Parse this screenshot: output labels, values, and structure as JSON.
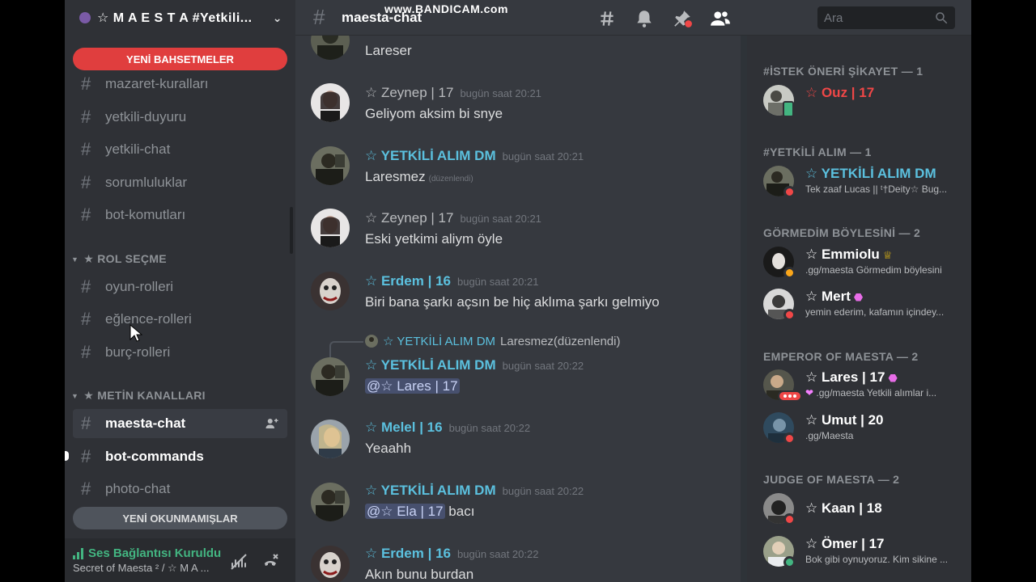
{
  "watermark": "www.BANDICAM.com",
  "guild": {
    "name": "☆ M A E S T A #Yetkili..."
  },
  "sidebar": {
    "new_mentions": "YENİ BAHSETMELER",
    "new_unreads": "YENİ OKUNMAMIŞLAR",
    "channels_top": [
      {
        "name": "mazaret-kuralları"
      },
      {
        "name": "yetkili-duyuru"
      },
      {
        "name": "yetkili-chat"
      },
      {
        "name": "sorumluluklar"
      },
      {
        "name": "bot-komutları"
      }
    ],
    "categories": [
      {
        "name": "★ ROL SEÇME"
      },
      {
        "name": "★ METİN KANALLARI"
      }
    ],
    "channels_role": [
      {
        "name": "oyun-rolleri"
      },
      {
        "name": "eğlence-rolleri"
      },
      {
        "name": "burç-rolleri"
      }
    ],
    "channels_text": [
      {
        "name": "maesta-chat"
      },
      {
        "name": "bot-commands"
      },
      {
        "name": "photo-chat"
      }
    ],
    "voice": {
      "status": "Ses Bağlantısı Kuruldu",
      "channel": "Secret of Maesta ² / ☆ M A ..."
    }
  },
  "header": {
    "channel": "maesta-chat",
    "search_placeholder": "Ara"
  },
  "messages": [
    {
      "author": "",
      "time": "",
      "content": "Lareser"
    },
    {
      "author": "☆ Zeynep | 17",
      "time": "bugün saat 20:21",
      "content": "Geliyom aksim bi snye"
    },
    {
      "author": "☆ YETKİLİ ALIM DM",
      "time": "bugün saat 20:21",
      "content": "Laresmez",
      "edited": "(düzenlendi)"
    },
    {
      "author": "☆ Zeynep | 17",
      "time": "bugün saat 20:21",
      "content": "Eski yetkimi aliym öyle"
    },
    {
      "author": "☆ Erdem | 16",
      "time": "bugün saat 20:21",
      "content": "Biri bana şarkı açsın be hiç aklıma şarkı gelmiyo"
    },
    {
      "author": "☆ YETKİLİ ALIM DM",
      "time": "bugün saat 20:22",
      "mention": "@☆ Lares | 17",
      "reply": {
        "author": "☆ YETKİLİ ALIM DM",
        "content": "Laresmez",
        "edited": "(düzenlendi)"
      }
    },
    {
      "author": "☆ Melel | 16",
      "time": "bugün saat 20:22",
      "content": "Yeaahh"
    },
    {
      "author": "☆ YETKİLİ ALIM DM",
      "time": "bugün saat 20:22",
      "mention": "@☆ Ela | 17",
      "content": "bacı"
    },
    {
      "author": "☆ Erdem | 16",
      "time": "bugün saat 20:22",
      "content": "Akın bunu burdan"
    }
  ],
  "members": {
    "groups": [
      {
        "title": "#İSTEK ÖNERİ ŞİKAYET — 1"
      },
      {
        "title": "#YETKİLİ ALIM — 1"
      },
      {
        "title": "GÖRMEDİM BÖYLESİNİ — 2"
      },
      {
        "title": "EMPEROR OF MAESTA — 2"
      },
      {
        "title": "JUDGE OF MAESTA — 2"
      }
    ],
    "list": [
      {
        "name": "☆ Ouz | 17",
        "sub": ""
      },
      {
        "name": "☆ YETKİLİ ALIM DM",
        "sub": "Tek zaaf Lucas || ᵗ†Deity☆ Bug..."
      },
      {
        "name": "☆ Emmiolu",
        "sub": ".gg/maesta Görmedim böylesini"
      },
      {
        "name": "☆ Mert",
        "sub": "yemin ederim, kafamın içindey..."
      },
      {
        "name": "☆ Lares | 17",
        "sub": ".gg/maesta Yetkili alımlar i..."
      },
      {
        "name": "☆ Umut | 20",
        "sub": ".gg/Maesta"
      },
      {
        "name": "☆ Kaan | 18",
        "sub": ""
      },
      {
        "name": "☆ Ömer | 17",
        "sub": "Bok gibi oynuyoruz. Kim sikine ..."
      }
    ]
  },
  "colors": {
    "accent_teal": "#5bc0de",
    "mention_red": "#e03e3e",
    "online": "#43b581",
    "dnd": "#f04747",
    "idle": "#faa61a"
  }
}
